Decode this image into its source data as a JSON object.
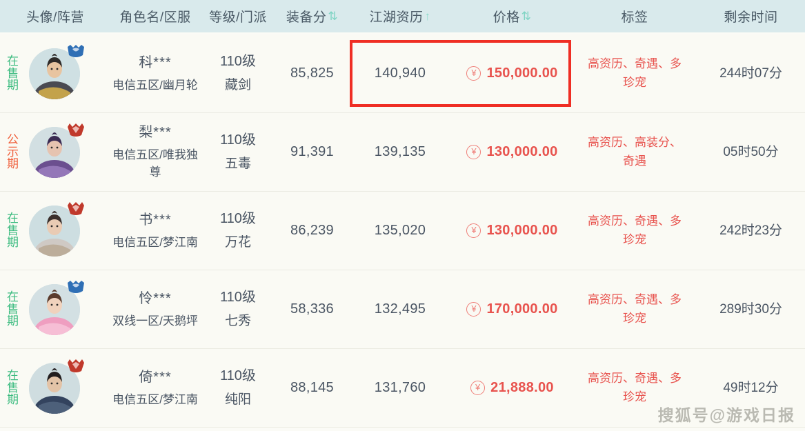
{
  "table": {
    "columns": [
      {
        "key": "avatar",
        "label": "头像/阵营",
        "sort": "none"
      },
      {
        "key": "name",
        "label": "角色名/区服",
        "sort": "none"
      },
      {
        "key": "level",
        "label": "等级/门派",
        "sort": "none"
      },
      {
        "key": "gear",
        "label": "装备分",
        "sort": "both"
      },
      {
        "key": "exp",
        "label": "江湖资历",
        "sort": "up"
      },
      {
        "key": "price",
        "label": "价格",
        "sort": "both"
      },
      {
        "key": "tag",
        "label": "标签",
        "sort": "none"
      },
      {
        "key": "time",
        "label": "剩余时间",
        "sort": "none"
      }
    ],
    "sort_glyph_both": "⇅",
    "sort_glyph_up": "↑",
    "currency_symbol": "¥",
    "rows": [
      {
        "status": "在售期",
        "status_type": "selling",
        "faction": "haoqi-emblem",
        "faction_color": "#2f6fb5",
        "avatar_theme": "swordsman-gold",
        "name": "科***",
        "server": "电信五区/幽月轮",
        "level": "110级",
        "school": "藏剑",
        "gear_score": "85,825",
        "experience": "140,940",
        "price": "150,000.00",
        "tags": "高资历、奇遇、多珍宠",
        "time_left": "244时07分",
        "highlighted": true
      },
      {
        "status": "公示期",
        "status_type": "public",
        "faction": "eren-emblem",
        "faction_color": "#c0392b",
        "avatar_theme": "purple-mage",
        "name": "梨***",
        "server": "电信五区/唯我独尊",
        "level": "110级",
        "school": "五毒",
        "gear_score": "91,391",
        "experience": "139,135",
        "price": "130,000.00",
        "tags": "高资历、高装分、奇遇",
        "time_left": "05时50分",
        "highlighted": false
      },
      {
        "status": "在售期",
        "status_type": "selling",
        "faction": "eren-emblem",
        "faction_color": "#c0392b",
        "avatar_theme": "white-scholar",
        "name": "书***",
        "server": "电信五区/梦江南",
        "level": "110级",
        "school": "万花",
        "gear_score": "86,239",
        "experience": "135,020",
        "price": "130,000.00",
        "tags": "高资历、奇遇、多珍宠",
        "time_left": "242时23分",
        "highlighted": false
      },
      {
        "status": "在售期",
        "status_type": "selling",
        "faction": "haoqi-emblem",
        "faction_color": "#2f6fb5",
        "avatar_theme": "pink-dancer",
        "name": "怜***",
        "server": "双线一区/天鹅坪",
        "level": "110级",
        "school": "七秀",
        "gear_score": "58,336",
        "experience": "132,495",
        "price": "170,000.00",
        "tags": "高资历、奇遇、多珍宠",
        "time_left": "289时30分",
        "highlighted": false
      },
      {
        "status": "在售期",
        "status_type": "selling",
        "faction": "eren-emblem",
        "faction_color": "#c0392b",
        "avatar_theme": "blue-swordsman",
        "name": "倚***",
        "server": "电信五区/梦江南",
        "level": "110级",
        "school": "纯阳",
        "gear_score": "88,145",
        "experience": "131,760",
        "price": "21,888.00",
        "tags": "高资历、奇遇、多珍宠",
        "time_left": "49时12分",
        "highlighted": false
      }
    ]
  },
  "watermark": {
    "text": "搜狐号@游戏日报"
  },
  "colors": {
    "header_bg": "#d9eaec",
    "row_bg": "#fafaf4",
    "price_red": "#e8534e",
    "tag_red": "#e8534e",
    "status_green": "#3bbb7f",
    "status_orange": "#f0603c",
    "highlight_border": "#ef2e24",
    "sort_teal": "#7fd4c4"
  }
}
